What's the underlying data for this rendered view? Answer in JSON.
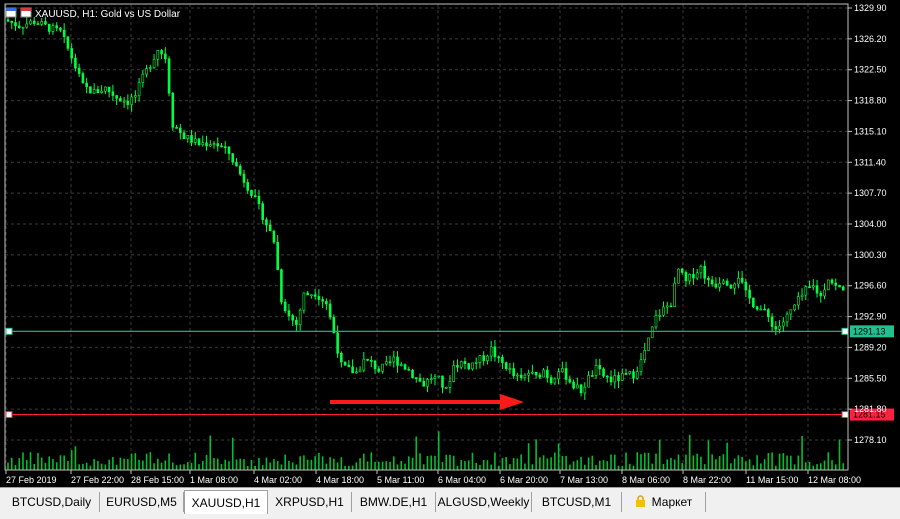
{
  "chart": {
    "title": "XAUUSD, H1:  Gold vs US Dollar",
    "yticks": [
      "1329.90",
      "1326.20",
      "1322.50",
      "1318.80",
      "1315.10",
      "1311.40",
      "1307.70",
      "1304.00",
      "1300.30",
      "1296.60",
      "1292.90",
      "1289.20",
      "1285.50",
      "1281.80",
      "1278.10"
    ],
    "xticks": [
      "27 Feb 2019",
      "27 Feb 22:00",
      "28 Feb 15:00",
      "1 Mar 08:00",
      "4 Mar 02:00",
      "4 Mar 18:00",
      "5 Mar 11:00",
      "6 Mar 04:00",
      "6 Mar 20:00",
      "7 Mar 13:00",
      "8 Mar 06:00",
      "8 Mar 22:00",
      "11 Mar 15:00",
      "12 Mar 08:00"
    ],
    "levels": [
      {
        "name": "hline-green",
        "value": "1291.13",
        "color": "#20c090"
      },
      {
        "name": "hline-red",
        "value": "1281.15",
        "color": "#ff2040"
      }
    ],
    "price_series_anchors": [
      [
        0,
        1328.5
      ],
      [
        4,
        1327.8
      ],
      [
        8,
        1328.3
      ],
      [
        12,
        1327.5
      ],
      [
        15,
        1327.0
      ],
      [
        18,
        1324.0
      ],
      [
        21,
        1320.5
      ],
      [
        24,
        1319.8
      ],
      [
        27,
        1320.3
      ],
      [
        30,
        1319.2
      ],
      [
        33,
        1318.7
      ],
      [
        35,
        1319.4
      ],
      [
        37,
        1321.5
      ],
      [
        39,
        1323.2
      ],
      [
        41,
        1325.0
      ],
      [
        43,
        1324.0
      ],
      [
        45,
        1316.0
      ],
      [
        48,
        1314.5
      ],
      [
        52,
        1313.6
      ],
      [
        56,
        1313.8
      ],
      [
        60,
        1312.5
      ],
      [
        63,
        1310.0
      ],
      [
        66,
        1307.8
      ],
      [
        69,
        1305.0
      ],
      [
        72,
        1302.0
      ],
      [
        74,
        1295.0
      ],
      [
        76,
        1293.0
      ],
      [
        78,
        1292.0
      ],
      [
        80,
        1295.5
      ],
      [
        83,
        1295.8
      ],
      [
        86,
        1294.5
      ],
      [
        88,
        1291.0
      ],
      [
        90,
        1287.0
      ],
      [
        92,
        1286.5
      ],
      [
        94,
        1286.2
      ],
      [
        96,
        1287.6
      ],
      [
        98,
        1287.3
      ],
      [
        100,
        1286.5
      ],
      [
        102,
        1287.0
      ],
      [
        104,
        1287.8
      ],
      [
        106,
        1287.2
      ],
      [
        108,
        1286.5
      ],
      [
        110,
        1285.5
      ],
      [
        112,
        1284.8
      ],
      [
        114,
        1285.6
      ],
      [
        116,
        1285.3
      ],
      [
        118,
        1284.0
      ],
      [
        120,
        1287.0
      ],
      [
        122,
        1287.4
      ],
      [
        124,
        1287.0
      ],
      [
        126,
        1287.5
      ],
      [
        128,
        1288.0
      ],
      [
        130,
        1289.0
      ],
      [
        132,
        1287.6
      ],
      [
        134,
        1287.0
      ],
      [
        136,
        1285.8
      ],
      [
        138,
        1285.3
      ],
      [
        140,
        1286.2
      ],
      [
        142,
        1285.6
      ],
      [
        144,
        1286.5
      ],
      [
        146,
        1285.2
      ],
      [
        148,
        1286.6
      ],
      [
        150,
        1285.8
      ],
      [
        152,
        1284.6
      ],
      [
        154,
        1284.0
      ],
      [
        156,
        1285.5
      ],
      [
        158,
        1286.6
      ],
      [
        160,
        1285.8
      ],
      [
        162,
        1285.3
      ],
      [
        164,
        1285.5
      ],
      [
        166,
        1285.8
      ],
      [
        168,
        1286.0
      ],
      [
        170,
        1287.5
      ],
      [
        172,
        1290.0
      ],
      [
        174,
        1292.8
      ],
      [
        176,
        1293.8
      ],
      [
        178,
        1294.5
      ],
      [
        180,
        1298.5
      ],
      [
        182,
        1297.0
      ],
      [
        184,
        1298.0
      ],
      [
        186,
        1298.8
      ],
      [
        188,
        1297.0
      ],
      [
        190,
        1296.8
      ],
      [
        192,
        1297.6
      ],
      [
        194,
        1296.7
      ],
      [
        196,
        1297.8
      ],
      [
        198,
        1295.6
      ],
      [
        200,
        1294.5
      ],
      [
        202,
        1293.8
      ],
      [
        204,
        1292.8
      ],
      [
        206,
        1291.4
      ],
      [
        208,
        1292.3
      ],
      [
        210,
        1293.5
      ],
      [
        212,
        1294.8
      ],
      [
        214,
        1296.0
      ],
      [
        216,
        1296.5
      ],
      [
        218,
        1295.3
      ],
      [
        220,
        1297.6
      ],
      [
        222,
        1296.5
      ],
      [
        224,
        1296.0
      ]
    ],
    "volume_baseline": "small",
    "colors": {
      "bg": "#000000",
      "grid": "#3a3a3a",
      "axis": "#ffffff",
      "candle": "#00ff40",
      "text": "#ffffff"
    }
  },
  "tabs": [
    {
      "label": "BTCUSD,Daily",
      "active": false
    },
    {
      "label": "EURUSD,M5",
      "active": false
    },
    {
      "label": "XAUUSD,H1",
      "active": true
    },
    {
      "label": "XRPUSD,H1",
      "active": false
    },
    {
      "label": "BMW.DE,H1",
      "active": false
    },
    {
      "label": "ALGUSD,Weekly",
      "active": false
    },
    {
      "label": "BTCUSD,M1",
      "active": false
    },
    {
      "label": "Маркет",
      "active": false,
      "icon": "lock-icon"
    }
  ]
}
